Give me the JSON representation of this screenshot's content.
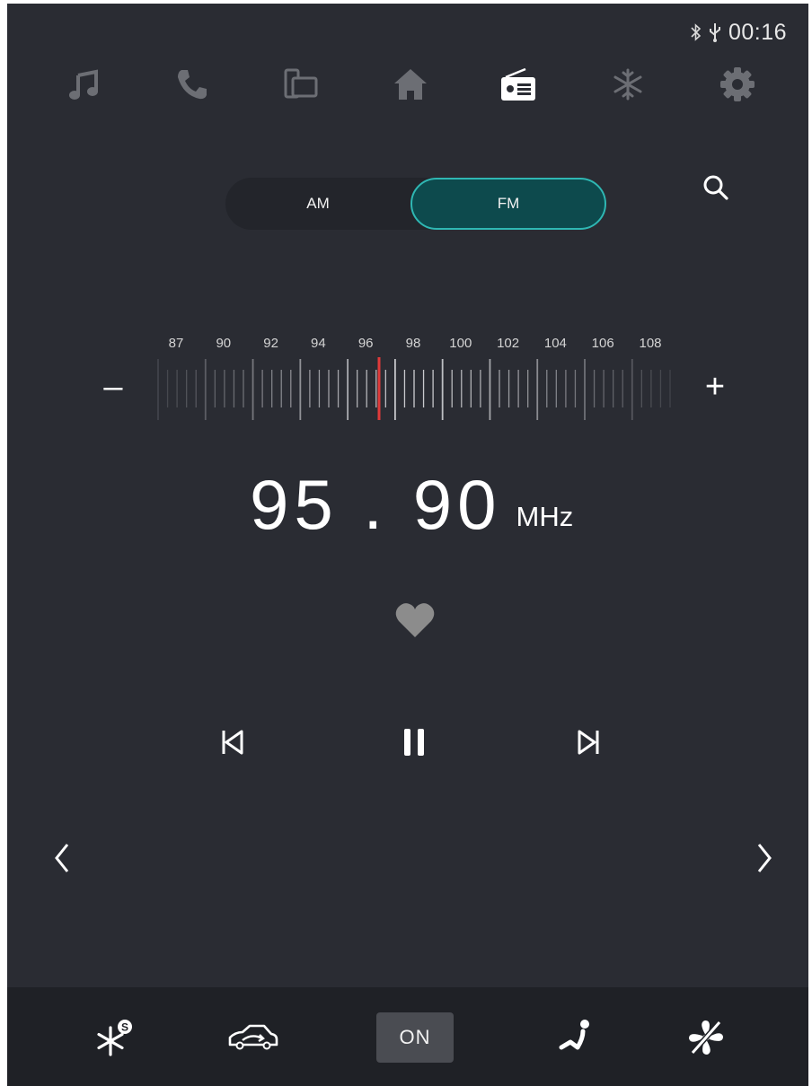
{
  "status": {
    "time": "00:16",
    "bluetooth_icon": "bluetooth-icon",
    "usb_icon": "usb-icon"
  },
  "nav": [
    {
      "id": "music",
      "icon": "music-note-icon",
      "active": false
    },
    {
      "id": "phone",
      "icon": "phone-icon",
      "active": false
    },
    {
      "id": "mirror",
      "icon": "screen-mirror-icon",
      "active": false
    },
    {
      "id": "home",
      "icon": "home-icon",
      "active": false
    },
    {
      "id": "radio",
      "icon": "radio-icon",
      "active": true
    },
    {
      "id": "climate",
      "icon": "snowflake-icon",
      "active": false
    },
    {
      "id": "settings",
      "icon": "gear-icon",
      "active": false
    }
  ],
  "band": {
    "am_label": "AM",
    "fm_label": "FM",
    "selected": "FM"
  },
  "scale": {
    "labels": [
      "87",
      "90",
      "92",
      "94",
      "96",
      "98",
      "100",
      "102",
      "104",
      "106",
      "108"
    ]
  },
  "tuner": {
    "minus_label": "–",
    "plus_label": "+"
  },
  "frequency": {
    "value": "95 . 90",
    "unit": "MHz"
  },
  "climate": {
    "on_label": "ON"
  },
  "colors": {
    "background": "#2a2c33",
    "accent": "#2fb7b3",
    "needle": "#e03a3a",
    "inactive_icon": "#6c6e74"
  }
}
